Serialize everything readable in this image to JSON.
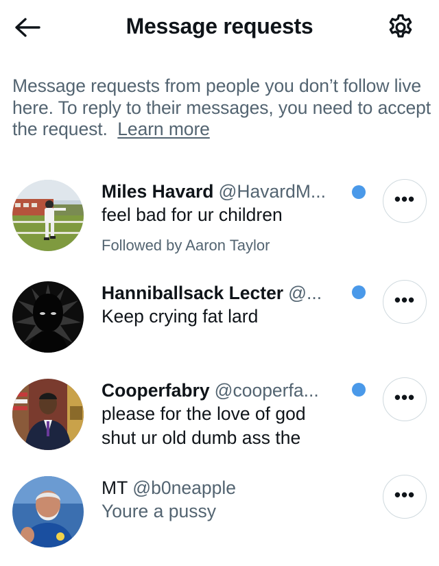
{
  "header": {
    "title": "Message requests",
    "back_icon": "arrow-left-icon",
    "settings_icon": "gear-icon"
  },
  "info": {
    "text": "Message requests from people you don’t follow live here. To reply to their messages, you need to accept the request.",
    "link": "Learn more"
  },
  "requests": [
    {
      "name": "Miles Havard",
      "handle": "@HavardM...",
      "message_lines": [
        "feel bad for ur children"
      ],
      "followed_by": "Followed by Aaron Taylor",
      "unread": true
    },
    {
      "name": "Hanniballsack Lecter",
      "handle": "@...",
      "message_lines": [
        "Keep crying fat lard"
      ],
      "unread": true
    },
    {
      "name": "Cooperfabry",
      "handle": "@cooperfa...",
      "message_lines": [
        "please for the love of god",
        "shut ur old dumb ass the"
      ],
      "unread": true
    },
    {
      "name": "MT",
      "handle": "@b0neapple",
      "message_lines": [
        "Youre a pussy"
      ],
      "unread": false
    }
  ],
  "more_button_label": "•••",
  "colors": {
    "text_primary": "#0f1419",
    "text_secondary": "#536471",
    "unread_dot": "#4a99e9",
    "button_border": "#cfd9de"
  }
}
